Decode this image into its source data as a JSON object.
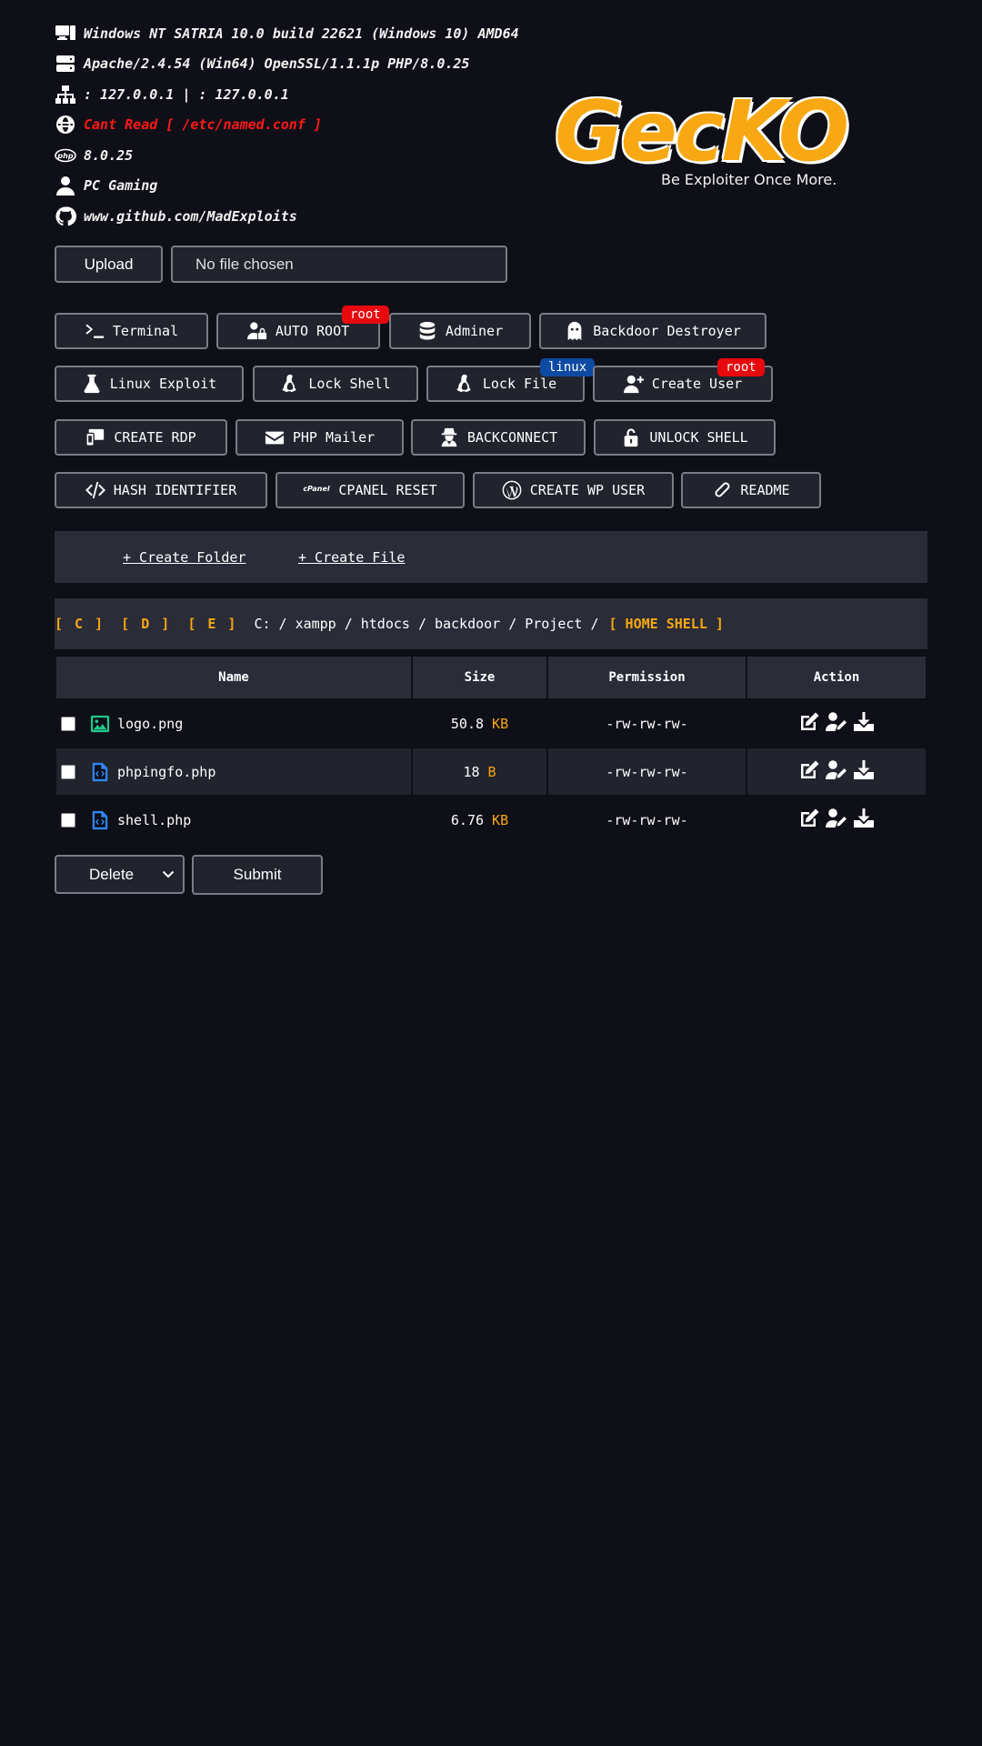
{
  "info": {
    "os": "Windows NT SATRIA 10.0 build 22621 (Windows 10) AMD64",
    "server": "Apache/2.4.54 (Win64) OpenSSL/1.1.1p PHP/8.0.25",
    "ip": ": 127.0.0.1 | : 127.0.0.1",
    "domains": "Cant Read [ /etc/named.conf ]",
    "php": "8.0.25",
    "user": "PC Gaming",
    "github": "www.github.com/MadExploits"
  },
  "logo": {
    "title": "GecKO",
    "tagline": "Be Exploiter Once More."
  },
  "upload": {
    "button": "Upload",
    "file_status": "No file chosen"
  },
  "tools": {
    "terminal": "Terminal",
    "auto_root": "AUTO ROOT",
    "auto_root_badge": "root",
    "adminer": "Adminer",
    "backdoor_destroyer": "Backdoor Destroyer",
    "linux_exploit": "Linux Exploit",
    "lock_shell": "Lock Shell",
    "lock_file": "Lock File",
    "lock_file_badge": "linux",
    "create_user": "Create User",
    "create_user_badge": "root",
    "create_rdp": "CREATE RDP",
    "php_mailer": "PHP Mailer",
    "backconnect": "BACKCONNECT",
    "unlock_shell": "UNLOCK SHELL",
    "hash_identifier": "HASH IDENTIFIER",
    "cpanel_reset": "CPANEL RESET",
    "cpanel_mark": "cPanel",
    "create_wp_user": "CREATE WP USER",
    "readme": "README"
  },
  "create": {
    "folder": "+ Create Folder",
    "file": "+ Create File"
  },
  "path": {
    "drives": [
      "[ C ]",
      "[ D ]",
      "[ E ]"
    ],
    "segments": [
      "C:",
      "xampp",
      "htdocs",
      "backdoor",
      "Project"
    ],
    "home": "[ HOME SHELL ]"
  },
  "table": {
    "headers": [
      "Name",
      "Size",
      "Permission",
      "Action"
    ],
    "rows": [
      {
        "name": "logo.png",
        "size": "50.8",
        "unit": "KB",
        "perm": "-rw-rw-rw-",
        "icon": "image-file-icon"
      },
      {
        "name": "phpingfo.php",
        "size": "18",
        "unit": "B",
        "perm": "-rw-rw-rw-",
        "icon": "code-file-icon"
      },
      {
        "name": "shell.php",
        "size": "6.76",
        "unit": "KB",
        "perm": "-rw-rw-rw-",
        "icon": "code-file-icon"
      }
    ]
  },
  "bulk": {
    "action": "Delete",
    "submit": "Submit"
  },
  "colors": {
    "background": "#0e0f17",
    "accent": "#f7a812",
    "danger": "#e8090e",
    "permission": "#1ed82c",
    "linux_badge": "#0d4aa3"
  }
}
